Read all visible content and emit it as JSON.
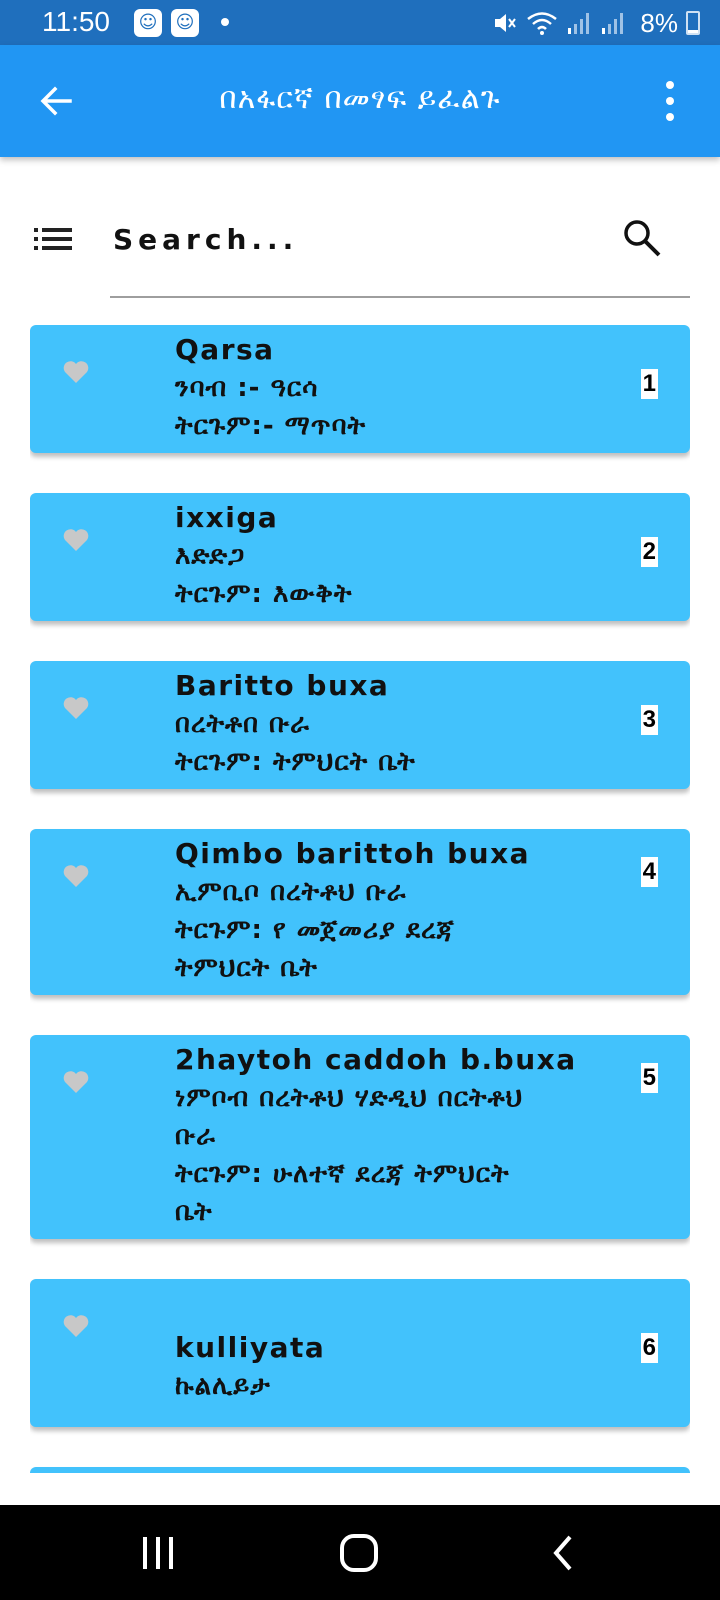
{
  "status_bar": {
    "time": "11:50",
    "battery": "8%",
    "icons": [
      "app-notification-icon",
      "app-notification-icon",
      "dot-icon",
      "mute-icon",
      "wifi-icon",
      "signal-icon",
      "signal-icon",
      "battery-charging-icon"
    ]
  },
  "app_bar": {
    "title": "በአፋርኛ በመፃፍ ይፈልጉ",
    "back_icon": "arrow-back-icon",
    "menu_icon": "more-vert-icon",
    "color": "#2196f3"
  },
  "search": {
    "placeholder": "Search...",
    "menu_icon": "list-icon",
    "search_icon": "search-icon"
  },
  "entries": [
    {
      "number": "1",
      "lines": [
        "Qarsa",
        "ንባብ :- ዓርሳ",
        "ትርጉም:- ማጥባት"
      ]
    },
    {
      "number": "2",
      "lines": [
        "ixxiga",
        "እድድጋ",
        "ትርጉም: እውቅት"
      ]
    },
    {
      "number": "3",
      "lines": [
        "Baritto buxa",
        "በረትቶበ ቡራ",
        "ትርጉም: ትምህርት ቤት"
      ]
    },
    {
      "number": "4",
      "lines": [
        "Qimbo barittoh buxa",
        "ኢምቢቦ በረትቶህ ቡራ",
        "ትርጉም: የ መጀመሪያ ደረጃ",
        "ትምህርት ቤት"
      ]
    },
    {
      "number": "5",
      "lines": [
        "2haytoh caddoh b.buxa",
        "ነምቦብ በረትቶህ ሃድዲህ በርትቶህ",
        "ቡራ",
        "ትርጉም: ሁለተኛ ደረጃ ትምህርት",
        "ቤት"
      ]
    },
    {
      "number": "6",
      "lines": [
        "",
        "kulliyata",
        "ኩልሊይታ"
      ]
    }
  ],
  "colors": {
    "card": "#42c2fc",
    "heart": "#c8c8c8",
    "status_bar": "#1f6fbd"
  },
  "nav_bar": {
    "icons": [
      "recent-apps-icon",
      "home-icon",
      "back-icon"
    ]
  }
}
